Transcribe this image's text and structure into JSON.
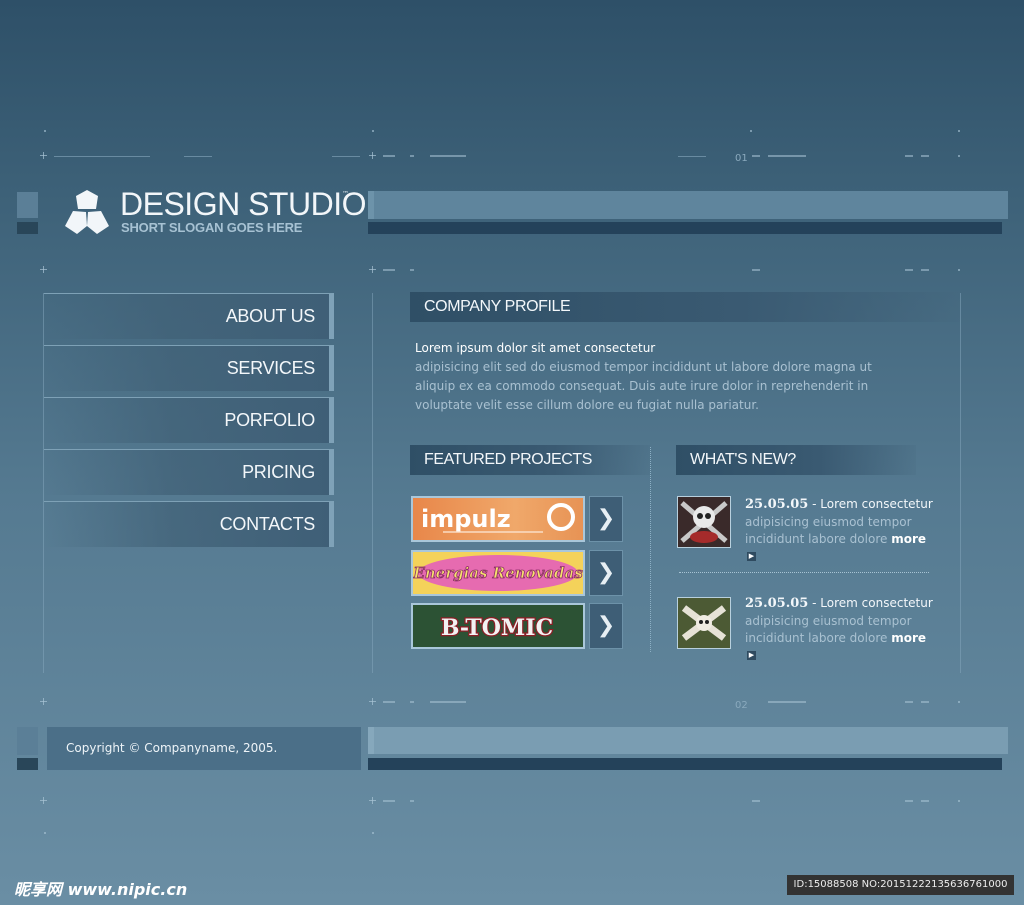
{
  "brand": {
    "title": "DESIGN STUDIO",
    "tm": "™",
    "slogan": "SHORT SLOGAN GOES HERE"
  },
  "markers": {
    "top": "01",
    "bottom": "02"
  },
  "nav": {
    "items": [
      {
        "label": "ABOUT US"
      },
      {
        "label": "SERVICES"
      },
      {
        "label": "PORFOLIO"
      },
      {
        "label": "PRICING"
      },
      {
        "label": "CONTACTS"
      }
    ]
  },
  "profile": {
    "heading": "COMPANY PROFILE",
    "lead": "Lorem ipsum dolor sit amet consectetur",
    "body": "adipisicing elit sed do eiusmod tempor incididunt ut labore dolore magna ut aliquip ex ea commodo consequat. Duis aute irure dolor in reprehenderit in voluptate velit esse cillum dolore eu fugiat nulla pariatur."
  },
  "projects": {
    "heading": "FEATURED PROJECTS",
    "items": [
      {
        "name": "impulz"
      },
      {
        "name": "Energias Renovadas"
      },
      {
        "name": "B-TOMIC"
      }
    ],
    "arrow": "❯"
  },
  "news": {
    "heading": "WHAT'S NEW?",
    "items": [
      {
        "date": "25.05.05",
        "title": " - Lorem consectetur",
        "text": "adipisicing eiusmod tempor incididunt labore dolore",
        "more": "more"
      },
      {
        "date": "25.05.05",
        "title": " - Lorem consectetur",
        "text": "adipisicing eiusmod tempor incididunt labore dolore",
        "more": "more"
      }
    ]
  },
  "footer": {
    "copyright": "Copyright © Companyname, 2005."
  },
  "watermark": {
    "left": "昵享网 www.nipic.cn",
    "right": "ID:15088508 NO:20151222135636761000"
  },
  "colors": {
    "background": "#3c6077",
    "accent": "#5f859d",
    "dark": "#24425a",
    "text_muted": "#a9c1d1"
  },
  "icons": {
    "logo": "pentagon-cluster-icon",
    "arrow": "chevron-right-icon",
    "more": "small-arrow-icon"
  }
}
